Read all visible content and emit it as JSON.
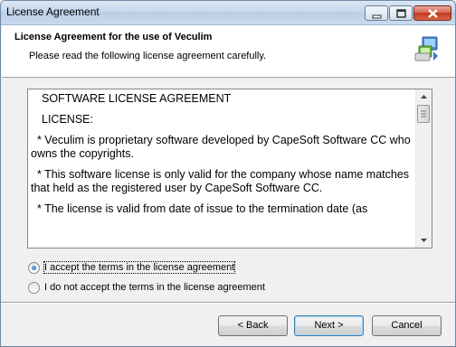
{
  "window": {
    "title": "License Agreement"
  },
  "header": {
    "title": "License Agreement for the use of Veculim",
    "subtitle": "Please read the following license agreement carefully."
  },
  "license": {
    "paragraphs": [
      "SOFTWARE LICENSE AGREEMENT",
      "LICENSE:",
      "  * Veculim is proprietary software developed by CapeSoft Software CC who owns the copyrights.",
      "  * This software license is only valid for the company whose name matches that held as the registered user by CapeSoft Software CC.",
      "  * The license is valid from date of issue to the termination date (as"
    ]
  },
  "options": {
    "accept": {
      "label": "I accept the terms in the license agreement",
      "selected": true
    },
    "decline": {
      "label": "I do not accept the terms in the license agreement",
      "selected": false
    }
  },
  "buttons": {
    "back": "< Back",
    "next": "Next >",
    "cancel": "Cancel"
  },
  "icons": {
    "header": "setup-computer-icon",
    "minimize": "minimize-icon",
    "maximize": "maximize-icon",
    "close": "close-icon"
  },
  "colors": {
    "titlebar": "#c6d8ec",
    "close_button": "#c0391e",
    "default_button_border": "#3c7fb1"
  }
}
